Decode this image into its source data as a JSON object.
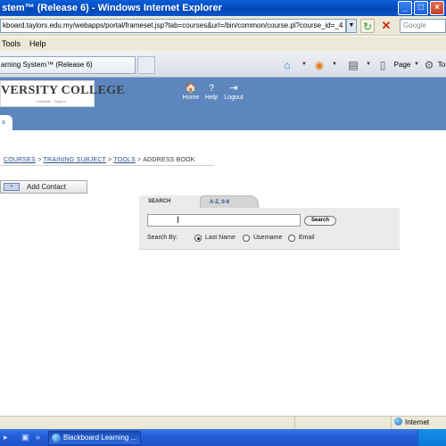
{
  "window": {
    "title": "stem™ (Release 6) - Windows Internet Explorer"
  },
  "address_bar": {
    "url": "kboard.taylors.edu.my/webapps/portal/frameset.jsp?tab=courses&url=/bin/common/course.pl?course_id=_4",
    "search_placeholder": "Google"
  },
  "menu": {
    "items": [
      "Tools",
      "Help"
    ]
  },
  "ie_tabs": {
    "active_tab": "arning System™ (Release 6)"
  },
  "command_bar": {
    "page_label": "Page",
    "tools_label": "To"
  },
  "bb_header": {
    "logo_text": "VERSITY COLLEGE",
    "logo_subtext": "Lakeside · Taylor's",
    "links": [
      {
        "label": "Home",
        "icon": "home-icon"
      },
      {
        "label": "Help",
        "icon": "help-icon"
      },
      {
        "label": "Logout",
        "icon": "logout-icon"
      }
    ],
    "tab_label": "s"
  },
  "breadcrumb": {
    "items": [
      "COURSES",
      "TRAINING SUBJECT",
      "TOOLS",
      "ADDRESS BOOK"
    ],
    "separator": ">"
  },
  "add_contact": {
    "label": "Add Contact"
  },
  "search_panel": {
    "tabs": [
      "SEARCH",
      "A-Z, 0-9"
    ],
    "input_value": "",
    "search_button": "Search",
    "search_by_label": "Search By:",
    "options": [
      {
        "label": "Last Name",
        "checked": true
      },
      {
        "label": "Username",
        "checked": false
      },
      {
        "label": "Email",
        "checked": false
      }
    ]
  },
  "status_bar": {
    "zone": "Internet"
  },
  "taskbar": {
    "task_label": "Blackboard Learning ..."
  }
}
